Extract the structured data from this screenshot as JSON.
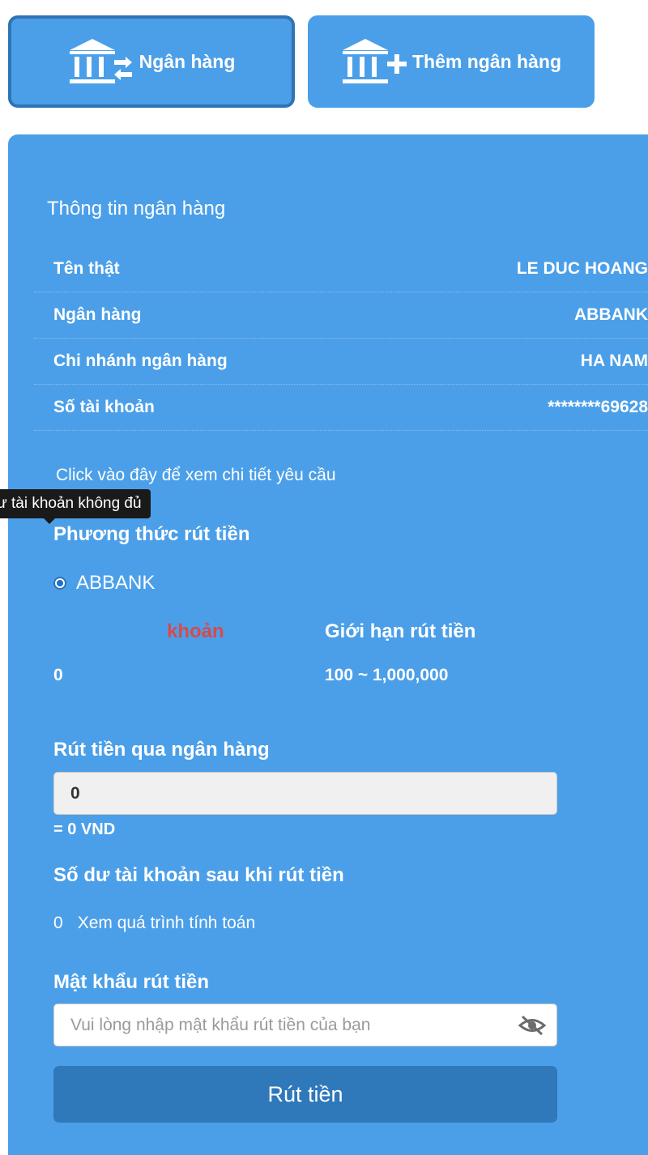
{
  "tabs": [
    {
      "label": "Ngân hàng",
      "icon": "bank-transfer-icon",
      "active": true
    },
    {
      "label": "Thêm ngân hàng",
      "icon": "bank-add-icon",
      "active": false
    }
  ],
  "bank_info": {
    "title": "Thông tin ngân hàng",
    "rows": [
      {
        "label": "Tên thật",
        "value": "LE DUC HOANG"
      },
      {
        "label": "Ngân hàng",
        "value": "ABBANK"
      },
      {
        "label": "Chi nhánh ngân hàng",
        "value": "HA NAM"
      },
      {
        "label": "Số tài khoản",
        "value": "********69628"
      }
    ]
  },
  "detail_link": "Click vào đây để xem chi tiết yêu cầu",
  "withdraw_method": {
    "title": "Phương thức rút tiền",
    "option": "ABBANK"
  },
  "balance": {
    "heading_visible": "khoản",
    "value": "0",
    "tooltip": "ư tài khoản không đủ"
  },
  "limit": {
    "heading": "Giới hạn rút tiền",
    "value": "100 ~ 1,000,000"
  },
  "amount": {
    "title": "Rút tiền qua ngân hàng",
    "value": "0",
    "converted": "= 0 VND"
  },
  "after": {
    "title": "Số dư tài khoản sau khi rút tiền",
    "value": "0",
    "calc_link": "Xem quá trình tính toán"
  },
  "password": {
    "title": "Mật khẩu rút tiền",
    "placeholder": "Vui lòng nhập mật khẩu rút tiền của bạn"
  },
  "submit_label": "Rút tiền",
  "colors": {
    "panel": "#4b9fe8",
    "active_border": "#2f74b4",
    "button": "#2f78ba",
    "warning_text": "#d84a4a"
  }
}
